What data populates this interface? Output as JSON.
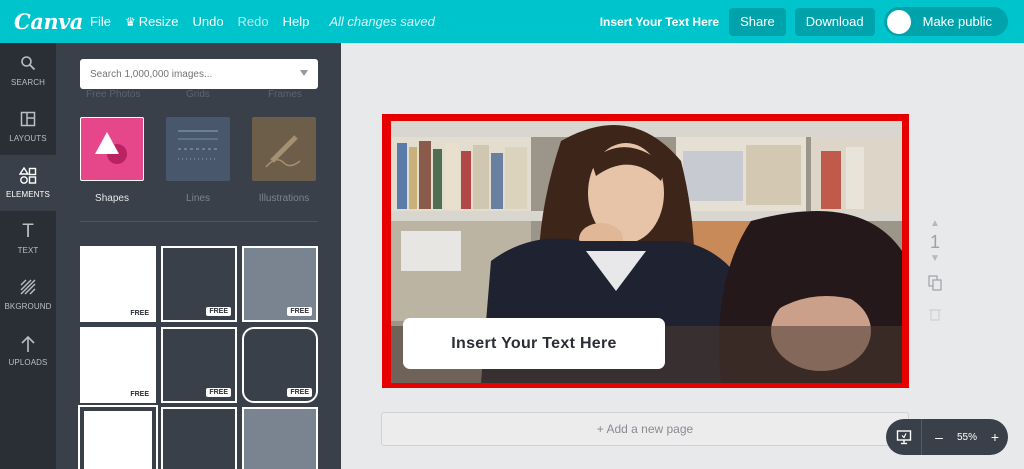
{
  "topbar": {
    "logo": "Canva",
    "menu": {
      "file": "File",
      "resize": "Resize",
      "undo": "Undo",
      "redo": "Redo",
      "help": "Help"
    },
    "status": "All changes saved",
    "doc_title": "Insert Your Text Here",
    "share": "Share",
    "download": "Download",
    "make_public": "Make public"
  },
  "rail": [
    {
      "label": "SEARCH",
      "icon": "search-icon"
    },
    {
      "label": "LAYOUTS",
      "icon": "layouts-icon"
    },
    {
      "label": "ELEMENTS",
      "icon": "elements-icon"
    },
    {
      "label": "TEXT",
      "icon": "text-icon"
    },
    {
      "label": "BKGROUND",
      "icon": "background-icon"
    },
    {
      "label": "UPLOADS",
      "icon": "uploads-icon"
    }
  ],
  "panel": {
    "search_placeholder": "Search 1,000,000 images...",
    "faded_labels": [
      "Free Photos",
      "Grids",
      "Frames"
    ],
    "categories": [
      {
        "label": "Shapes",
        "active": true
      },
      {
        "label": "Lines",
        "active": false
      },
      {
        "label": "Illustrations",
        "active": false
      }
    ],
    "free_tag": "FREE"
  },
  "canvas": {
    "text_box": "Insert Your Text Here",
    "page_number": "1",
    "add_page": "+ Add a new page"
  },
  "zoom": {
    "minus": "–",
    "value": "55%",
    "plus": "+"
  },
  "colors": {
    "brand": "#00c4cc",
    "frame_border": "#e60000",
    "panel_bg": "#3a4049",
    "rail_bg": "#2a2e35"
  }
}
